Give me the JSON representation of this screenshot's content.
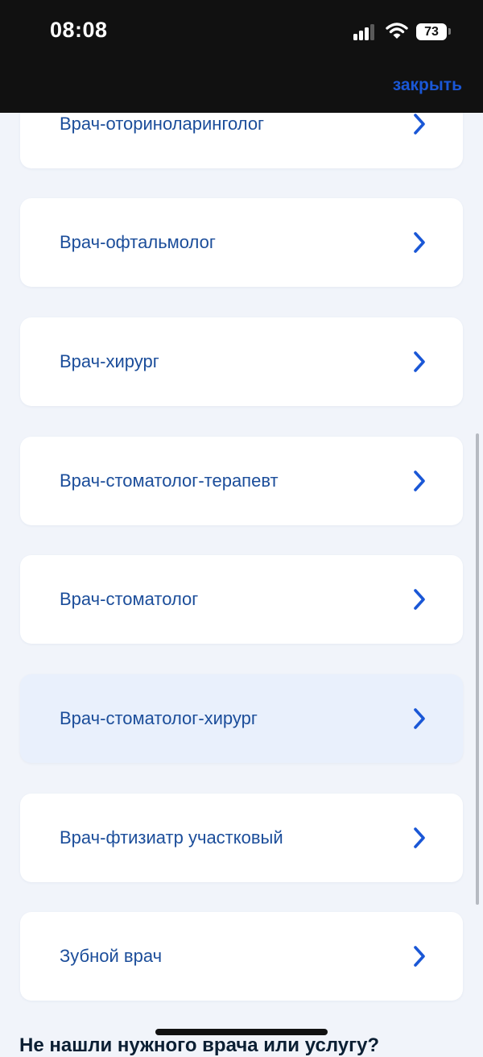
{
  "status_bar": {
    "time": "08:08",
    "battery": "73",
    "icons": [
      "signal-icon",
      "wifi-icon",
      "battery-icon"
    ]
  },
  "header": {
    "close_label": "закрыть"
  },
  "doctors": [
    {
      "label": "Врач-оториноларинголог"
    },
    {
      "label": "Врач-офтальмолог"
    },
    {
      "label": "Врач-хирург"
    },
    {
      "label": "Врач-стоматолог-терапевт"
    },
    {
      "label": "Врач-стоматолог"
    },
    {
      "label": "Врач-стоматолог-хирург",
      "highlighted": true
    },
    {
      "label": "Врач-фтизиатр участковый"
    },
    {
      "label": "Зубной врач"
    }
  ],
  "footer": {
    "not_found_text": "Не нашли нужного врача или услугу?"
  },
  "colors": {
    "accent": "#1a57d6",
    "label": "#1b4d9a",
    "background": "#f1f4fa",
    "card": "#ffffff",
    "card_highlight": "#e9f0fc"
  }
}
